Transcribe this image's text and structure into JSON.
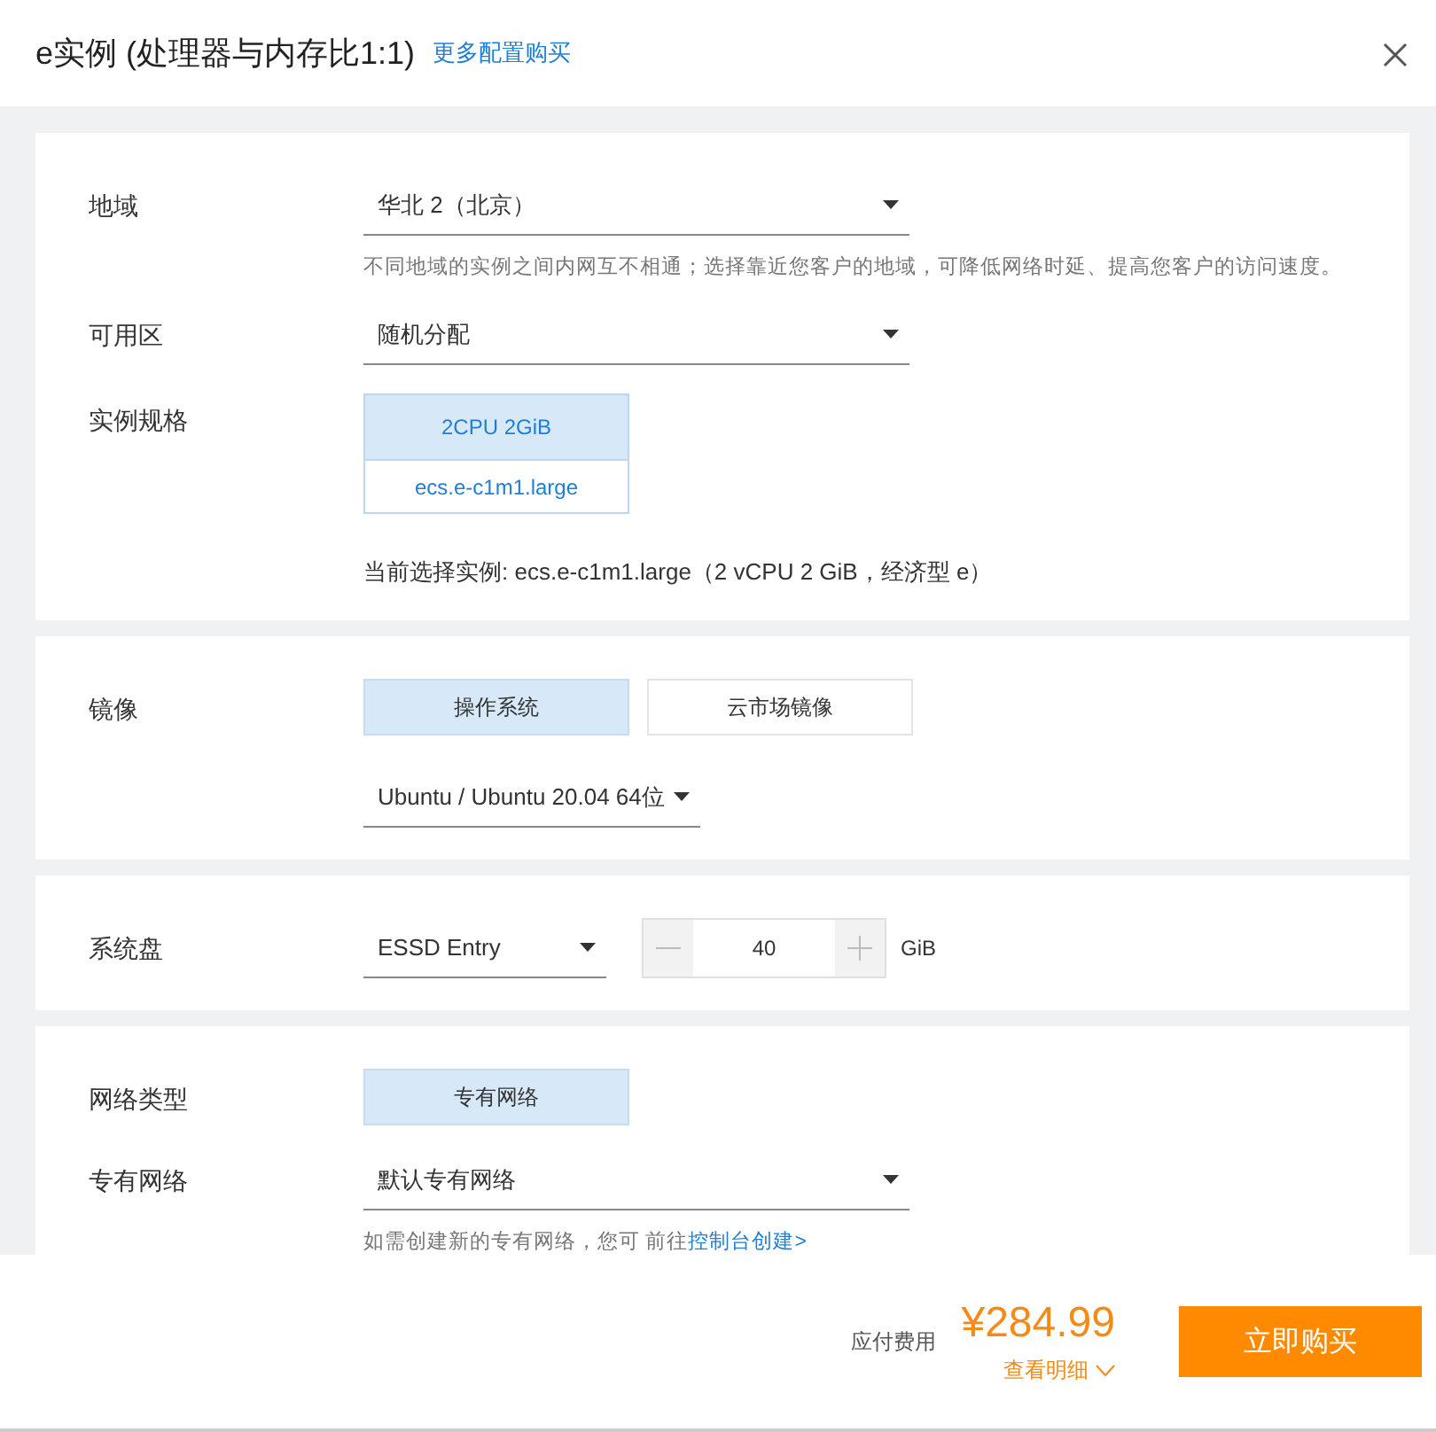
{
  "header": {
    "title": "e实例 (处理器与内存比1:1)",
    "link": "更多配置购买"
  },
  "sections": [
    {
      "rows": [
        {
          "kind": "select",
          "label": "地域",
          "value": "华北 2（北京）",
          "hint": "不同地域的实例之间内网互不相通；选择靠近您客户的地域，可降低网络时延、提高您客户的访问速度。"
        },
        {
          "kind": "select",
          "label": "可用区",
          "value": "随机分配"
        },
        {
          "kind": "spec",
          "label": "实例规格",
          "spec": {
            "title": "2CPU 2GiB",
            "name": "ecs.e-c1m1.large",
            "selected": true
          },
          "note": "当前选择实例: ecs.e-c1m1.large（2 vCPU 2 GiB，经济型 e）"
        }
      ]
    },
    {
      "rows": [
        {
          "kind": "options",
          "label": "镜像",
          "options": [
            {
              "label": "操作系统",
              "selected": true
            },
            {
              "label": "云市场镜像",
              "selected": false
            }
          ],
          "select": "Ubuntu / Ubuntu 20.04 64位"
        }
      ]
    },
    {
      "rows": [
        {
          "kind": "disk",
          "label": "系统盘",
          "select": "ESSD Entry",
          "amount": "40",
          "unit": "GiB"
        }
      ]
    },
    {
      "rows": [
        {
          "kind": "options",
          "label": "网络类型",
          "options": [
            {
              "label": "专有网络",
              "selected": true
            }
          ]
        },
        {
          "kind": "select",
          "label": "专有网络",
          "value": "默认专有网络",
          "hint": "如需创建新的专有网络，您可 前往",
          "hint_link": "控制台创建>"
        }
      ]
    }
  ],
  "footer": {
    "fee_label": "应付费用",
    "price": "¥284.99",
    "details": "查看明细",
    "buy": "立即购买"
  }
}
